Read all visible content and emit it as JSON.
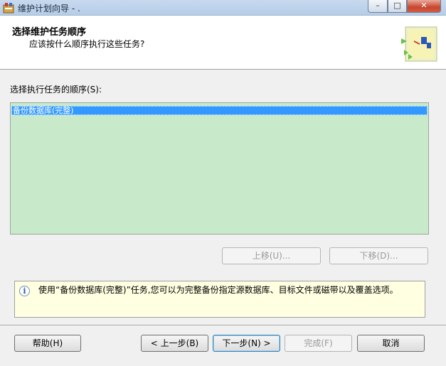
{
  "window": {
    "title": "维护计划向导 - .",
    "minimize_glyph": "–",
    "maximize_glyph": "□",
    "close_glyph": "✕"
  },
  "header": {
    "title": "选择维护任务顺序",
    "subtitle": "应该按什么顺序执行这些任务?"
  },
  "task_list": {
    "label": "选择执行任务的顺序(S):",
    "items": [
      {
        "label": "备份数据库(完整)",
        "selected": true
      }
    ]
  },
  "order_buttons": {
    "up_label": "上移(U)...",
    "down_label": "下移(D)..."
  },
  "info": {
    "icon": "info-icon",
    "icon_glyph": "i",
    "text": "使用“备份数据库(完整)”任务,您可以为完整备份指定源数据库、目标文件或磁带以及覆盖选项。"
  },
  "footer": {
    "help_label": "帮助(H)",
    "back_label": "< 上一步(B)",
    "next_label": "下一步(N) >",
    "finish_label": "完成(F)",
    "cancel_label": "取消"
  },
  "colors": {
    "list_background": "#c8eacb",
    "selection": "#3399ff",
    "info_background": "#ffffe1"
  }
}
